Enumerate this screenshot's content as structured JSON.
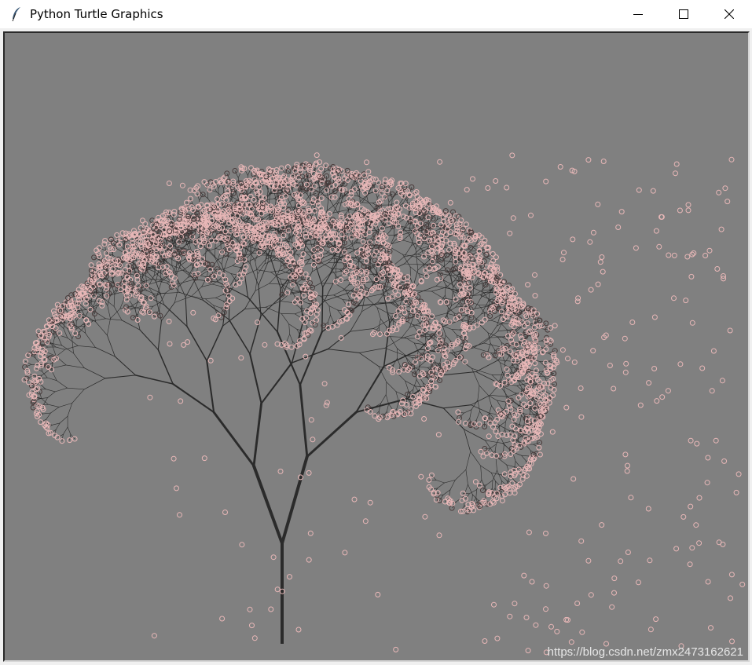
{
  "window": {
    "title": "Python Turtle Graphics",
    "app_icon": "feather-icon",
    "controls": [
      "minimize-icon",
      "maximize-icon",
      "close-icon"
    ]
  },
  "canvas": {
    "background": "#808080",
    "trunk_color": "#2b2b2b",
    "blossom_color": "#e8b7b7"
  },
  "watermark": "https://blog.csdn.net/zmx2473162621"
}
